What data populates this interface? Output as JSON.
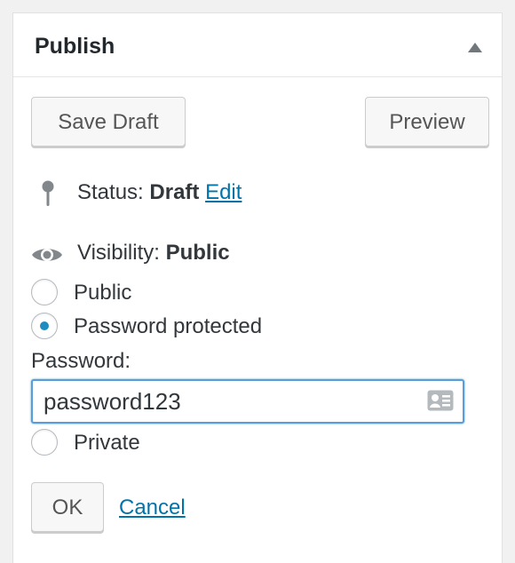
{
  "publish": {
    "title": "Publish",
    "save_draft_label": "Save Draft",
    "preview_label": "Preview",
    "status": {
      "label": "Status:",
      "value": "Draft",
      "edit_link": "Edit"
    },
    "visibility": {
      "label": "Visibility:",
      "value": "Public",
      "options": [
        {
          "label": "Public",
          "checked": false
        },
        {
          "label": "Password protected",
          "checked": true
        },
        {
          "label": "Private",
          "checked": false
        }
      ],
      "password_label": "Password:",
      "password_value": "password123"
    },
    "ok_label": "OK",
    "cancel_label": "Cancel"
  },
  "icons": {
    "toggle": "triangle-up-icon",
    "status": "pin-icon",
    "visibility": "eye-icon",
    "password_manager": "contact-card-icon"
  },
  "colors": {
    "link": "#0073aa",
    "radio_checked": "#1e8cbe",
    "focus_border": "#5b9dd9"
  }
}
